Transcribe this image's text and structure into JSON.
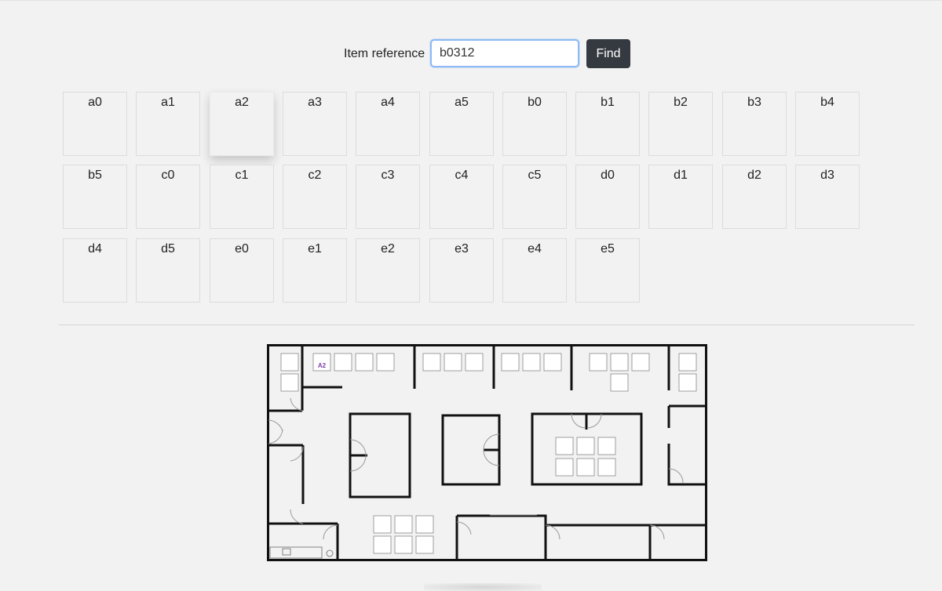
{
  "search": {
    "label": "Item reference",
    "value": "b0312",
    "button_label": "Find"
  },
  "tiles": [
    "a0",
    "a1",
    "a2",
    "a3",
    "a4",
    "a5",
    "b0",
    "b1",
    "b2",
    "b3",
    "b4",
    "b5",
    "c0",
    "c1",
    "c2",
    "c3",
    "c4",
    "c5",
    "d0",
    "d1",
    "d2",
    "d3",
    "d4",
    "d5",
    "e0",
    "e1",
    "e2",
    "e3",
    "e4",
    "e5"
  ],
  "hovered_tile": "a2",
  "floorplan": {
    "highlight_label": "A2",
    "highlight_color": "#7b3fb0"
  }
}
